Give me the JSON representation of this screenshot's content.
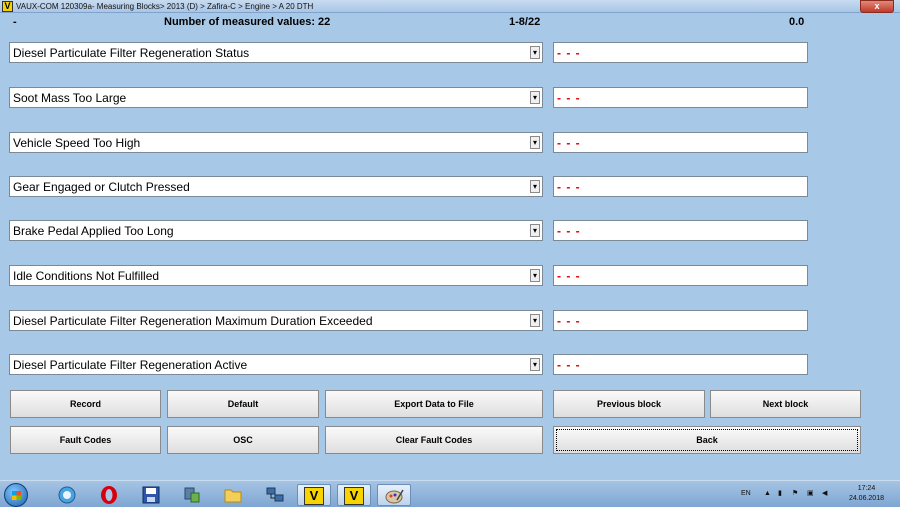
{
  "window": {
    "icon_letter": "V",
    "title": "VAUX-COM 120309a- Measuring Blocks> 2013 (D) > Zafira-C > Engine > A 20 DTH",
    "close_label": "x"
  },
  "header": {
    "dash": "-",
    "count_label": "Number of measured values: 22",
    "range": "1-8/22",
    "value": "0.0"
  },
  "rows": [
    {
      "label": "Diesel Particulate Filter Regeneration Status",
      "value": "- - -"
    },
    {
      "label": "Soot Mass Too Large",
      "value": "- - -"
    },
    {
      "label": "Vehicle Speed Too High",
      "value": "- - -"
    },
    {
      "label": "Gear Engaged or Clutch Pressed",
      "value": "- - -"
    },
    {
      "label": "Brake Pedal Applied Too Long",
      "value": "- - -"
    },
    {
      "label": "Idle Conditions Not Fulfilled",
      "value": "- - -"
    },
    {
      "label": "Diesel Particulate Filter Regeneration Maximum Duration Exceeded",
      "value": "- - -"
    },
    {
      "label": "Diesel Particulate Filter Regeneration Active",
      "value": "- - -"
    }
  ],
  "buttons": {
    "record": "Record",
    "default": "Default",
    "export": "Export Data to File",
    "previous": "Previous block",
    "next": "Next block",
    "fault_codes": "Fault Codes",
    "osc": "OSC",
    "clear_fault_codes": "Clear Fault Codes",
    "back": "Back"
  },
  "taskbar": {
    "vaux_letter": "V",
    "vaux_letter_2": "V",
    "language": "EN",
    "time": "17:24",
    "date": "24.06.2018"
  }
}
